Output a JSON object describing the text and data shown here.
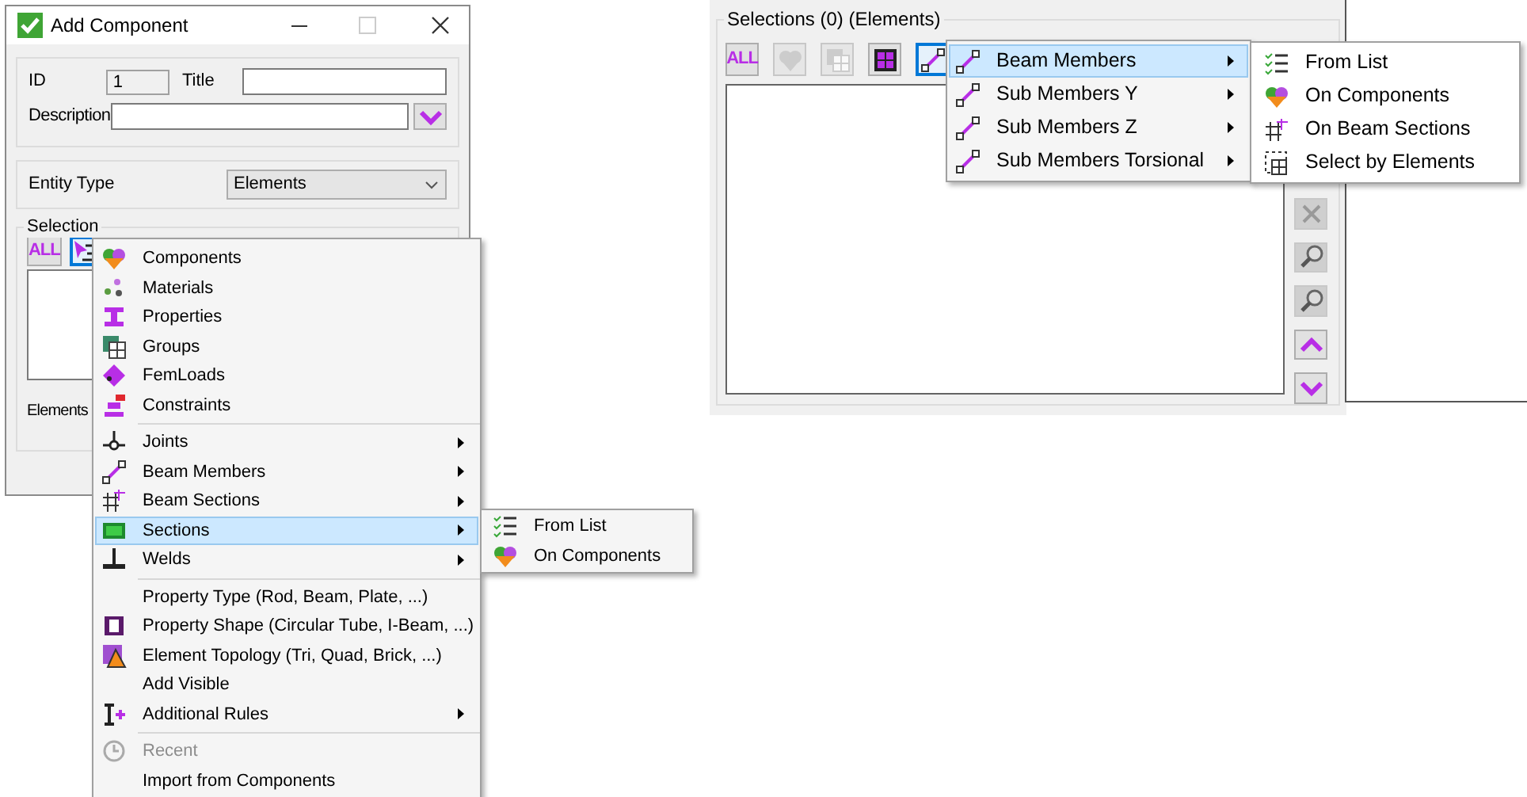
{
  "dialog": {
    "title": "Add Component",
    "id_label": "ID",
    "id_value": "1",
    "title_label": "Title",
    "description_label": "Description",
    "entity_type_label": "Entity Type",
    "entity_type_value": "Elements",
    "selection_label": "Selection",
    "elements_label": "Elements",
    "toolbar": [
      {
        "kind": "all",
        "label": "ALL",
        "selected": false,
        "disabled": false
      },
      {
        "kind": "list",
        "selected": true,
        "disabled": false
      }
    ]
  },
  "context_menu": {
    "items": [
      {
        "kind": "components",
        "label": "Components",
        "submenu": false,
        "selected": false,
        "disabled": false
      },
      {
        "kind": "materials",
        "label": "Materials",
        "submenu": false,
        "selected": false,
        "disabled": false
      },
      {
        "kind": "properties",
        "label": "Properties",
        "submenu": false,
        "selected": false,
        "disabled": false
      },
      {
        "kind": "groups",
        "label": "Groups",
        "submenu": false,
        "selected": false,
        "disabled": false
      },
      {
        "kind": "femloads",
        "label": "FemLoads",
        "submenu": false,
        "selected": false,
        "disabled": false
      },
      {
        "kind": "constraints",
        "label": "Constraints",
        "submenu": false,
        "selected": false,
        "disabled": false
      },
      {
        "kind": "separator"
      },
      {
        "kind": "joints",
        "label": "Joints",
        "submenu": true,
        "selected": false,
        "disabled": false
      },
      {
        "kind": "beam",
        "label": "Beam Members",
        "submenu": true,
        "selected": false,
        "disabled": false
      },
      {
        "kind": "beam_sections",
        "label": "Beam Sections",
        "submenu": true,
        "selected": false,
        "disabled": false
      },
      {
        "kind": "sections",
        "label": "Sections",
        "submenu": true,
        "selected": true,
        "disabled": false
      },
      {
        "kind": "welds",
        "label": "Welds",
        "submenu": true,
        "selected": false,
        "disabled": false
      },
      {
        "kind": "separator"
      },
      {
        "kind": "plain",
        "label": "Property Type (Rod, Beam, Plate, ...)",
        "submenu": false,
        "selected": false,
        "disabled": false
      },
      {
        "kind": "shape",
        "label": "Property Shape (Circular Tube, I-Beam, ...)",
        "submenu": false,
        "selected": false,
        "disabled": false
      },
      {
        "kind": "topology",
        "label": "Element Topology (Tri, Quad, Brick, ...)",
        "submenu": false,
        "selected": false,
        "disabled": false
      },
      {
        "kind": "plain",
        "label": "Add Visible",
        "submenu": false,
        "selected": false,
        "disabled": false
      },
      {
        "kind": "rules",
        "label": "Additional Rules",
        "submenu": true,
        "selected": false,
        "disabled": false
      },
      {
        "kind": "separator"
      },
      {
        "kind": "recent",
        "label": "Recent",
        "submenu": false,
        "selected": false,
        "disabled": true
      },
      {
        "kind": "plain",
        "label": "Import from Components",
        "submenu": false,
        "selected": false,
        "disabled": false
      }
    ]
  },
  "sections_submenu": {
    "items": [
      {
        "kind": "list",
        "label": "From List"
      },
      {
        "kind": "components",
        "label": "On Components"
      }
    ]
  },
  "selections_panel": {
    "title": "Selections (0) (Elements)",
    "toolbar": [
      {
        "kind": "all",
        "label": "ALL",
        "selected": false,
        "disabled": false
      },
      {
        "kind": "components",
        "selected": false,
        "disabled": true
      },
      {
        "kind": "groups",
        "selected": false,
        "disabled": true
      },
      {
        "kind": "grid",
        "selected": false,
        "disabled": false
      },
      {
        "kind": "beam",
        "selected": true,
        "disabled": false
      }
    ],
    "side_buttons": [
      {
        "kind": "remove",
        "disabled": true
      },
      {
        "kind": "zoom",
        "disabled": true
      },
      {
        "kind": "zoom",
        "disabled": true
      },
      {
        "kind": "up",
        "disabled": false
      },
      {
        "kind": "down",
        "disabled": false
      }
    ]
  },
  "members_menu": {
    "items": [
      {
        "label": "Beam Members",
        "selected": true
      },
      {
        "label": "Sub Members Y",
        "selected": false
      },
      {
        "label": "Sub Members Z",
        "selected": false
      },
      {
        "label": "Sub Members Torsional",
        "selected": false
      }
    ]
  },
  "members_submenu": {
    "items": [
      {
        "kind": "list",
        "label": "From List"
      },
      {
        "kind": "components",
        "label": "On Components"
      },
      {
        "kind": "beam_sections",
        "label": "On Beam Sections"
      },
      {
        "kind": "select_elements",
        "label": "Select by Elements"
      }
    ]
  }
}
